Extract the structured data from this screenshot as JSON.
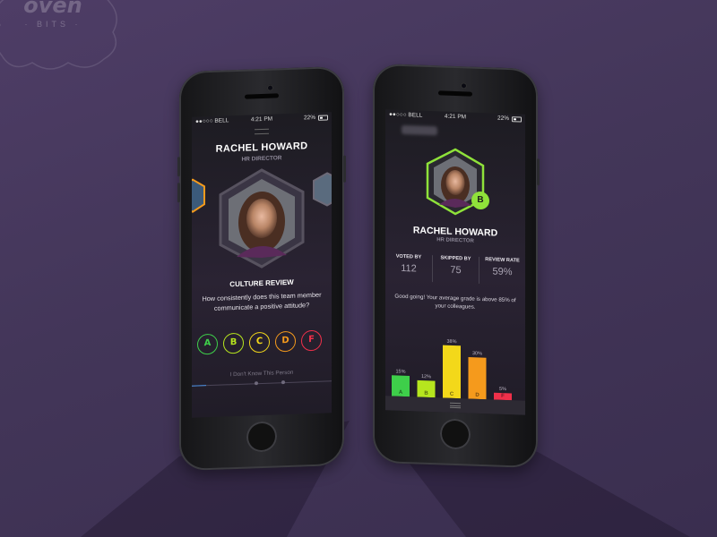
{
  "logo": {
    "text": "oven",
    "sub": "· BITS ·"
  },
  "status_bar": {
    "carrier": "●●○○○ BELL",
    "time": "4:21 PM",
    "battery": "22%"
  },
  "left_screen": {
    "name": "RACHEL HOWARD",
    "role": "HR DIRECTOR",
    "section": "CULTURE REVIEW",
    "question": "How consistently does this team member communicate a positive attitude?",
    "grades": [
      {
        "label": "A",
        "color": "#3ecf4a"
      },
      {
        "label": "B",
        "color": "#b6e51e"
      },
      {
        "label": "C",
        "color": "#f3d81a"
      },
      {
        "label": "D",
        "color": "#f59a1c"
      },
      {
        "label": "F",
        "color": "#f0304a"
      }
    ],
    "dont_know": "I Don't Know This Person",
    "progress": 0.1
  },
  "right_screen": {
    "grade_badge": "B",
    "name": "RACHEL HOWARD",
    "role": "HR DIRECTOR",
    "stats": [
      {
        "label": "VOTED BY",
        "value": "112"
      },
      {
        "label": "SKIPPED BY",
        "value": "75"
      },
      {
        "label": "REVIEW RATE",
        "value": "59%"
      }
    ],
    "message": "Good going! Your average grade is above 85% of your colleagues.",
    "accent": "#8fe23a"
  },
  "chart_data": {
    "type": "bar",
    "categories": [
      "A",
      "B",
      "C",
      "D",
      "F"
    ],
    "values": [
      15,
      12,
      38,
      30,
      5
    ],
    "labels": [
      "15%",
      "12%",
      "38%",
      "30%",
      "5%"
    ],
    "colors": [
      "#3ecf4a",
      "#b6e51e",
      "#f3d81a",
      "#f59a1c",
      "#f0304a"
    ],
    "ylim": [
      0,
      40
    ]
  }
}
